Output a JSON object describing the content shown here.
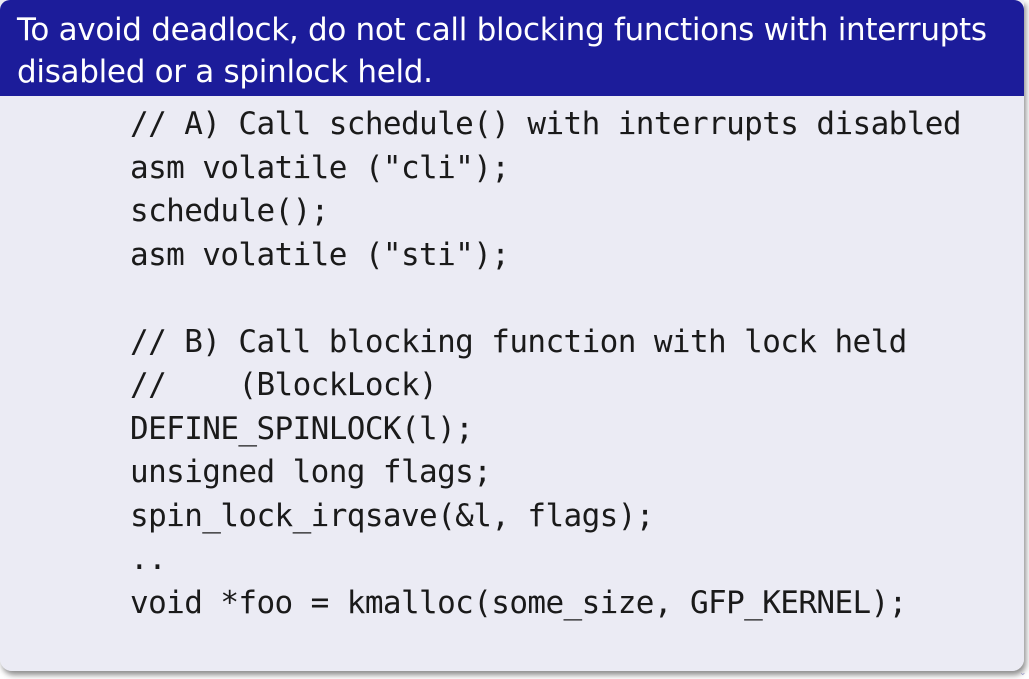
{
  "block": {
    "title_lines": [
      "To avoid deadlock, do not call blocking functions with interrupts",
      "disabled or a spinlock held."
    ],
    "code_lines": [
      "// A) Call schedule() with interrupts disabled",
      "asm volatile (\"cli\");",
      "schedule();",
      "asm volatile (\"sti\");",
      "",
      "// B) Call blocking function with lock held",
      "//    (BlockLock)",
      "DEFINE_SPINLOCK(l);",
      "unsigned long flags;",
      "spin_lock_irqsave(&l, flags);",
      "..",
      "void *foo = kmalloc(some_size, GFP_KERNEL);"
    ]
  },
  "colors": {
    "title_background": "#1c1c9a",
    "title_text": "#ffffff",
    "body_background": "#ebebf4",
    "code_text": "#1a1a1a"
  },
  "icons": {
    "nav": "chevron-down-icon"
  }
}
